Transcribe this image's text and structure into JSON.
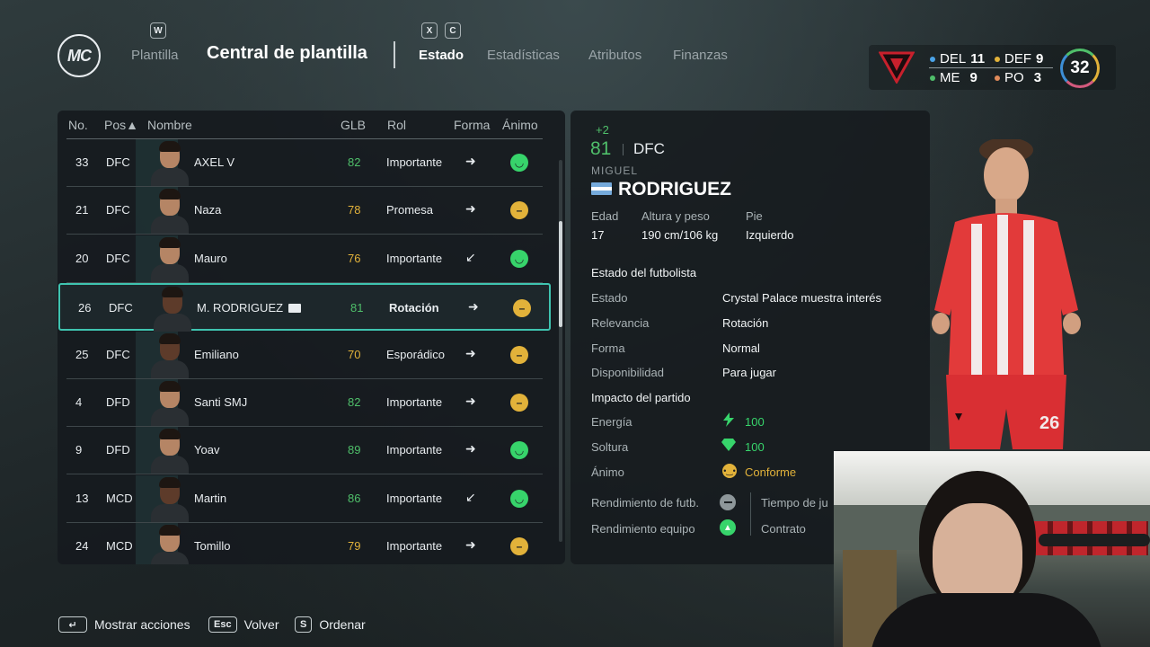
{
  "header": {
    "logo_text": "MC",
    "tab_left_key": "W",
    "tab_plantilla": "Plantilla",
    "title": "Central de plantilla",
    "key_x": "X",
    "key_c": "C",
    "subtabs": [
      "Estado",
      "Estadísticas",
      "Atributos",
      "Finanzas"
    ],
    "active_subtab": "Estado"
  },
  "team_summary": {
    "del_label": "DEL",
    "del_count": "11",
    "def_label": "DEF",
    "def_count": "9",
    "me_label": "ME",
    "me_count": "9",
    "po_label": "PO",
    "po_count": "3",
    "squad_size": "32",
    "colors": {
      "del": "#4aa3e8",
      "def": "#e2b23a",
      "me": "#4fbf6a",
      "po": "#e08a5a"
    }
  },
  "list": {
    "columns": [
      "No.",
      "Pos▲",
      "Nombre",
      "GLB",
      "Rol",
      "Forma",
      "Ánimo"
    ],
    "rows": [
      {
        "no": "33",
        "pos": "DFC",
        "name": "AXEL V",
        "glb": "82",
        "glb_color": "#4fbf6a",
        "role": "Importante",
        "form": "➜",
        "mood": "happy"
      },
      {
        "no": "21",
        "pos": "DFC",
        "name": "Naza",
        "glb": "78",
        "glb_color": "#e2b23a",
        "role": "Promesa",
        "form": "➜",
        "mood": "neutral"
      },
      {
        "no": "20",
        "pos": "DFC",
        "name": "Mauro",
        "glb": "76",
        "glb_color": "#e2b23a",
        "role": "Importante",
        "form": "↙",
        "mood": "happy"
      },
      {
        "no": "26",
        "pos": "DFC",
        "name": "M. RODRIGUEZ",
        "glb": "81",
        "glb_color": "#4fbf6a",
        "role": "Rotación",
        "form": "➜",
        "mood": "neutral",
        "selected": true
      },
      {
        "no": "25",
        "pos": "DFC",
        "name": "Emiliano",
        "glb": "70",
        "glb_color": "#e2b23a",
        "role": "Esporádico",
        "form": "➜",
        "mood": "neutral"
      },
      {
        "no": "4",
        "pos": "DFD",
        "name": "Santi SMJ",
        "glb": "82",
        "glb_color": "#4fbf6a",
        "role": "Importante",
        "form": "➜",
        "mood": "neutral"
      },
      {
        "no": "9",
        "pos": "DFD",
        "name": "Yoav",
        "glb": "89",
        "glb_color": "#4fbf6a",
        "role": "Importante",
        "form": "➜",
        "mood": "happy"
      },
      {
        "no": "13",
        "pos": "MCD",
        "name": "Martin",
        "glb": "86",
        "glb_color": "#4fbf6a",
        "role": "Importante",
        "form": "↙",
        "mood": "happy"
      },
      {
        "no": "24",
        "pos": "MCD",
        "name": "Tomillo",
        "glb": "79",
        "glb_color": "#e2b23a",
        "role": "Importante",
        "form": "➜",
        "mood": "neutral"
      }
    ]
  },
  "player": {
    "delta": "+2",
    "overall": "81",
    "position": "DFC",
    "first_name": "MIGUEL",
    "last_name": "RODRIGUEZ",
    "age_label": "Edad",
    "age": "17",
    "hw_label": "Altura y peso",
    "hw": "190 cm/106 kg",
    "foot_label": "Pie",
    "foot": "Izquierdo",
    "status_section": "Estado del futbolista",
    "status": [
      {
        "label": "Estado",
        "value": "Crystal Palace muestra interés"
      },
      {
        "label": "Relevancia",
        "value": "Rotación"
      },
      {
        "label": "Forma",
        "value": "Normal"
      },
      {
        "label": "Disponibilidad",
        "value": "Para jugar"
      }
    ],
    "impact_section": "Impacto del partido",
    "energy_label": "Energía",
    "energy": "100",
    "sharpness_label": "Soltura",
    "sharpness": "100",
    "morale_label": "Ánimo",
    "morale": "Conforme",
    "perf_label": "Rendimiento de futb.",
    "team_perf_label": "Rendimiento equipo",
    "playtime_label": "Tiempo de ju",
    "contract_label": "Contrato",
    "shirt_number": "26"
  },
  "footer": {
    "key_enter": "↵",
    "actions": "Mostrar acciones",
    "key_esc": "Esc",
    "back": "Volver",
    "key_s": "S",
    "sort": "Ordenar"
  }
}
